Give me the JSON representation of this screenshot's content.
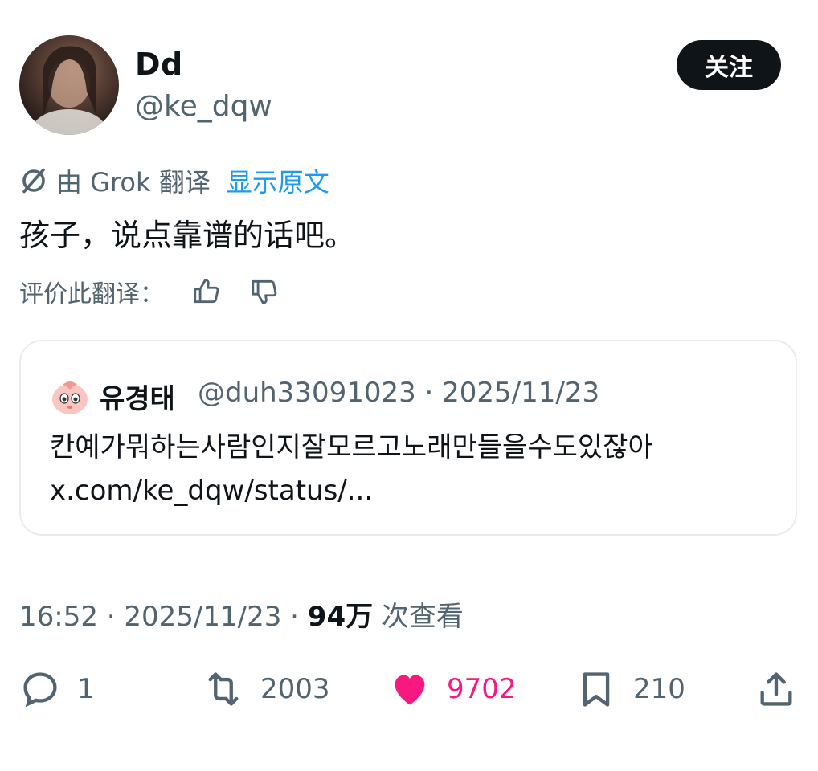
{
  "author": {
    "display_name": "Dd",
    "handle": "@ke_dqw",
    "follow_label": "关注"
  },
  "translation": {
    "by_label": "由 Grok 翻译",
    "show_original_label": "显示原文",
    "translated_text": "孩子，说点靠谱的话吧。",
    "rate_label": "评价此翻译："
  },
  "quote": {
    "name": "유경태",
    "meta": "@duh33091023 · 2025/11/23",
    "text": "칸예가뭐하는사람인지잘모르고노래만들을수도있잖아",
    "link": "x.com/ke_dqw/status/..."
  },
  "timestamp": {
    "time": "16:52 · 2025/11/23 · ",
    "views": "94万",
    "views_label": " 次查看"
  },
  "actions": {
    "replies": "1",
    "retweets": "2003",
    "likes": "9702",
    "bookmarks": "210"
  },
  "colors": {
    "accent": "#1d9bf0",
    "like": "#f91880",
    "muted": "#536471",
    "text": "#0f1419"
  }
}
